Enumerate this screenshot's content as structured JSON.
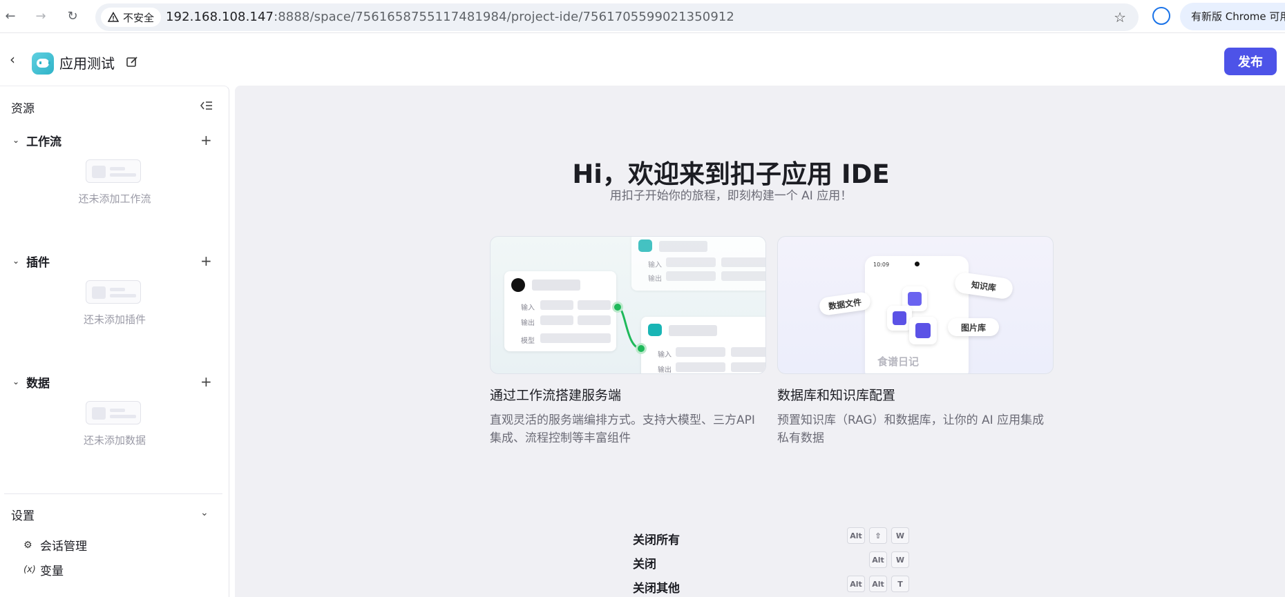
{
  "browser": {
    "security_label": "不安全",
    "url_host": "192.168.108.147",
    "url_rest": ":8888/space/7561658755117481984/project-ide/7561705599021350912",
    "update_label": "有新版 Chrome 可用"
  },
  "header": {
    "app_title": "应用测试",
    "publish_label": "发布"
  },
  "sidebar": {
    "title": "资源",
    "groups": [
      {
        "label": "工作流",
        "empty": "还未添加工作流"
      },
      {
        "label": "插件",
        "empty": "还未添加插件"
      },
      {
        "label": "数据",
        "empty": "还未添加数据"
      }
    ],
    "settings_label": "设置",
    "settings_items": [
      {
        "label": "会话管理",
        "icon": "chat-settings-icon"
      },
      {
        "label": "变量",
        "icon": "variable-icon"
      }
    ]
  },
  "main": {
    "title": "Hi，欢迎来到扣子应用 IDE",
    "subtitle": "用扣子开始你的旅程，即刻构建一个 AI 应用！",
    "cards": [
      {
        "title": "通过工作流搭建服务端",
        "desc": "直观灵活的服务端编排方式。支持大模型、三方API集成、流程控制等丰富组件",
        "labels": {
          "input": "输入",
          "output": "输出",
          "model": "模型"
        }
      },
      {
        "title": "数据库和知识库配置",
        "desc": "预置知识库（RAG）和数据库，让你的 AI 应用集成私有数据",
        "labels": {
          "data_file": "数据文件",
          "knowledge": "知识库",
          "image_lib": "图片库",
          "recipe": "食谱日记",
          "time": "10:09"
        }
      }
    ],
    "shortcuts": [
      {
        "label": "关闭所有",
        "keys": [
          "Alt",
          "⇧",
          "W"
        ]
      },
      {
        "label": "关闭",
        "keys": [
          "Alt",
          "W"
        ]
      },
      {
        "label": "关闭其他",
        "keys": [
          "Alt",
          "Alt",
          "T"
        ]
      }
    ]
  },
  "colors": {
    "brand": "#4d53e8",
    "green": "#1fb95a",
    "teal": "#19b5b5"
  }
}
